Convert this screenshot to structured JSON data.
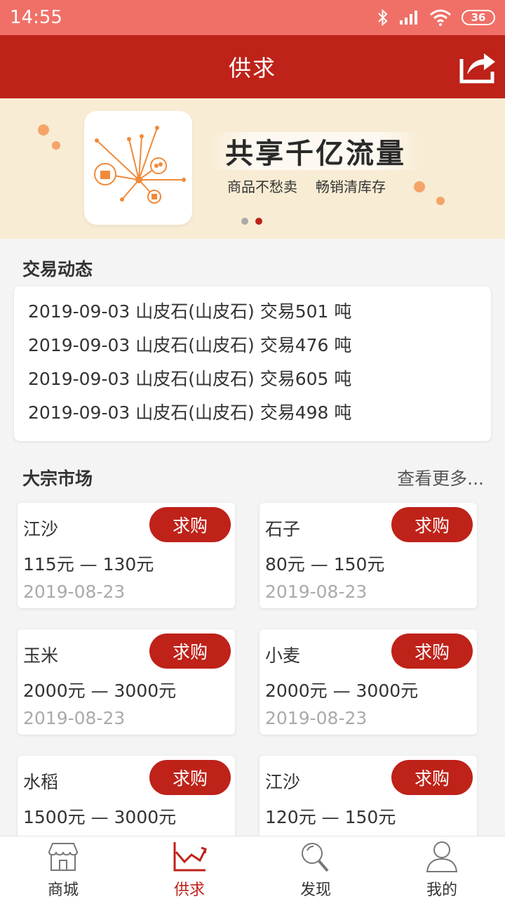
{
  "status_bar": {
    "time": "14:55",
    "battery": "36"
  },
  "header": {
    "title": "供求"
  },
  "banner": {
    "title": "共享千亿流量",
    "sub1": "商品不愁卖",
    "sub2": "畅销清库存"
  },
  "trade_section": {
    "title": "交易动态",
    "items": [
      "2019-09-03 山皮石(山皮石) 交易501 吨",
      "2019-09-03 山皮石(山皮石) 交易476 吨",
      "2019-09-03 山皮石(山皮石) 交易605 吨",
      "2019-09-03 山皮石(山皮石) 交易498 吨"
    ]
  },
  "market_section": {
    "title": "大宗市场",
    "more": "查看更多..."
  },
  "cards": [
    {
      "name": "江沙",
      "price": "115元 — 130元",
      "date": "2019-08-23",
      "button": "求购"
    },
    {
      "name": "石子",
      "price": "80元 — 150元",
      "date": "2019-08-23",
      "button": "求购"
    },
    {
      "name": "玉米",
      "price": "2000元 — 3000元",
      "date": "2019-08-23",
      "button": "求购"
    },
    {
      "name": "小麦",
      "price": "2000元 — 3000元",
      "date": "2019-08-23",
      "button": "求购"
    },
    {
      "name": "水稻",
      "price": "1500元 — 3000元",
      "date": "",
      "button": "求购"
    },
    {
      "name": "江沙",
      "price": "120元 — 150元",
      "date": "",
      "button": "求购"
    }
  ],
  "tabs": [
    {
      "label": "商城",
      "icon": "store-icon"
    },
    {
      "label": "供求",
      "icon": "chart-icon"
    },
    {
      "label": "发现",
      "icon": "search-icon"
    },
    {
      "label": "我的",
      "icon": "user-icon"
    }
  ],
  "colors": {
    "primary": "#be2219",
    "status_bar": "#f07067",
    "banner_bg": "#f8ecd4"
  }
}
